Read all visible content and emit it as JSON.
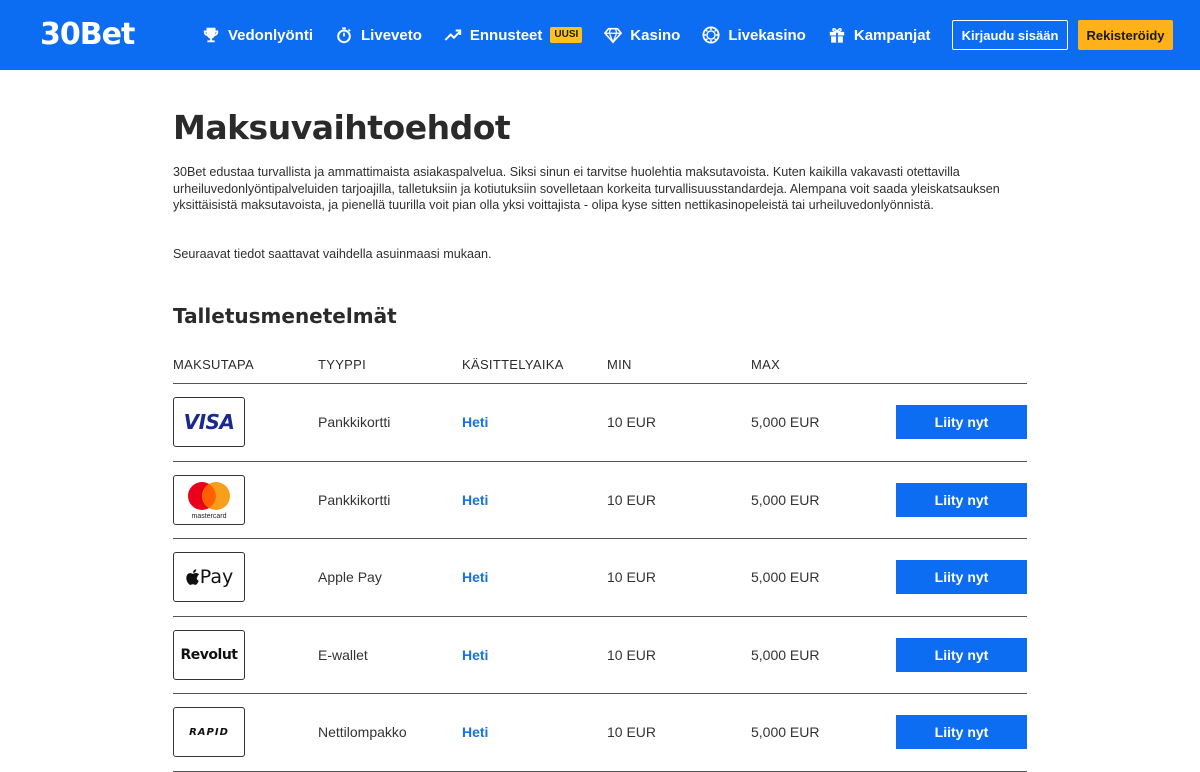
{
  "header": {
    "logo": "30Bet",
    "nav": [
      {
        "label": "Vedonlyönti",
        "icon": "trophy-icon"
      },
      {
        "label": "Liveveto",
        "icon": "stopwatch-icon"
      },
      {
        "label": "Ennusteet",
        "icon": "trend-up-icon",
        "badge": "UUSI"
      },
      {
        "label": "Kasino",
        "icon": "diamond-icon"
      },
      {
        "label": "Livekasino",
        "icon": "chip-icon"
      },
      {
        "label": "Kampanjat",
        "icon": "gift-icon"
      }
    ],
    "login_label": "Kirjaudu sisään",
    "register_label": "Rekisteröidy",
    "colors": {
      "bar": "#0c6cf2",
      "register": "#ffb11a",
      "badge": "#ffc21a"
    }
  },
  "main": {
    "title": "Maksuvaihtoehdot",
    "intro": "30Bet edustaa turvallista ja ammattimaista asiakaspalvelua. Siksi sinun ei tarvitse huolehtia maksutavoista. Kuten kaikilla vakavasti otettavilla urheiluvedonlyöntipalveluiden tarjoajilla, talletuksiin ja kotiutuksiin sovelletaan korkeita turvallisuusstandardeja. Alempana voit saada yleiskatsauksen yksittäisistä maksutavoista, ja pienellä tuurilla voit pian olla yksi voittajista - olipa kyse sitten nettikasinopeleistä tai urheiluvedonlyönnistä.",
    "note": "Seuraavat tiedot saattavat vaihdella asuinmaasi mukaan.",
    "section_title": "Talletusmenetelmät",
    "table": {
      "headers": [
        "MAKSUTAPA",
        "TYYPPI",
        "KÄSITTELYAIKA",
        "MIN",
        "MAX"
      ],
      "rows": [
        {
          "logo": "VISA",
          "type": "Pankkikortti",
          "time": "Heti",
          "min": "10 EUR",
          "max": "5,000 EUR",
          "button": "Liity nyt"
        },
        {
          "logo": "mastercard",
          "type": "Pankkikortti",
          "time": "Heti",
          "min": "10 EUR",
          "max": "5,000 EUR",
          "button": "Liity nyt"
        },
        {
          "logo": "Pay",
          "type": "Apple Pay",
          "time": "Heti",
          "min": "10 EUR",
          "max": "5,000 EUR",
          "button": "Liity nyt"
        },
        {
          "logo": "Revolut",
          "type": "E-wallet",
          "time": "Heti",
          "min": "10 EUR",
          "max": "5,000 EUR",
          "button": "Liity nyt"
        },
        {
          "logo": "RAPID",
          "type": "Nettilompakko",
          "time": "Heti",
          "min": "10 EUR",
          "max": "5,000 EUR",
          "button": "Liity nyt"
        }
      ]
    },
    "colors": {
      "button": "#0c6cf2",
      "time": "#1673e6"
    }
  }
}
